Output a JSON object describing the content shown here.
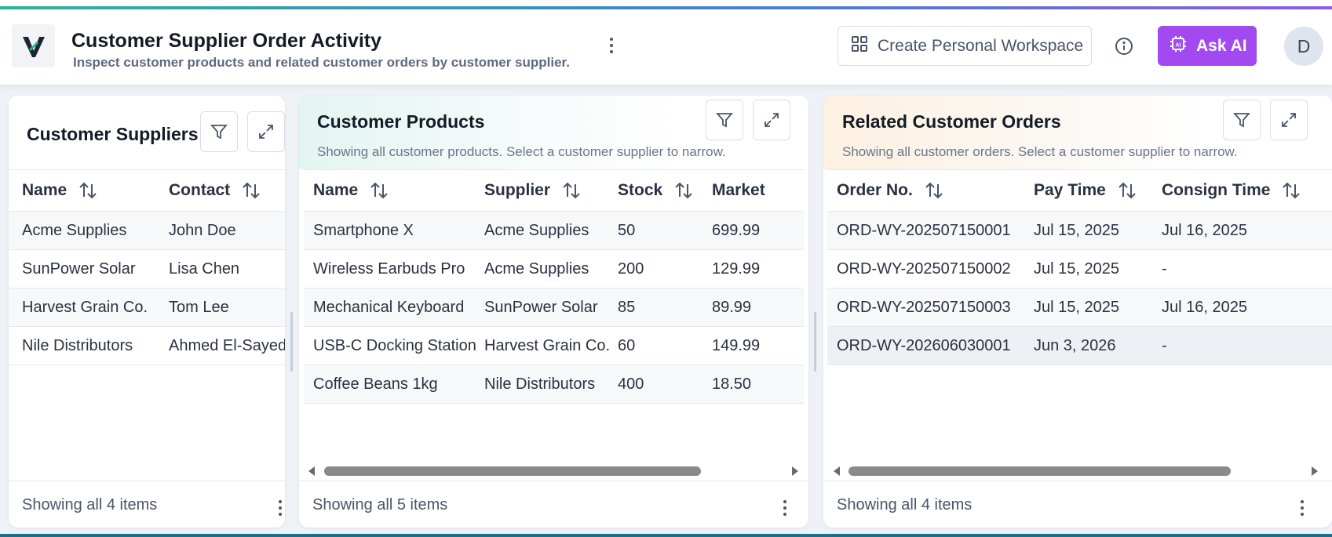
{
  "header": {
    "title": "Customer Supplier Order Activity",
    "subtitle": "Inspect customer products and related customer orders by customer supplier.",
    "workspace_label": "Create Personal Workspace",
    "ask_ai_label": "Ask AI",
    "avatar_initial": "D"
  },
  "colors": {
    "accent": "#a24af0",
    "gradient": [
      "#2bb39a",
      "#3f87c9",
      "#8e5ce6"
    ]
  },
  "suppliers": {
    "title": "Customer Suppliers",
    "columns": [
      "Name",
      "Contact"
    ],
    "rows": [
      [
        "Acme Supplies",
        "John Doe"
      ],
      [
        "SunPower Solar",
        "Lisa Chen"
      ],
      [
        "Harvest Grain Co.",
        "Tom Lee"
      ],
      [
        "Nile Distributors",
        "Ahmed El-Sayed"
      ]
    ],
    "footer": "Showing all 4 items"
  },
  "products": {
    "title": "Customer Products",
    "description": "Showing all customer products. Select a customer supplier to narrow.",
    "columns": [
      "Name",
      "Supplier",
      "Stock",
      "Market Price"
    ],
    "rows": [
      [
        "Smartphone X",
        "Acme Supplies",
        "50",
        "699.99"
      ],
      [
        "Wireless Earbuds Pro",
        "Acme Supplies",
        "200",
        "129.99"
      ],
      [
        "Mechanical Keyboard",
        "SunPower Solar",
        "85",
        "89.99"
      ],
      [
        "USB-C Docking Station",
        "Harvest Grain Co.",
        "60",
        "149.99"
      ],
      [
        "Coffee Beans 1kg",
        "Nile Distributors",
        "400",
        "18.50"
      ]
    ],
    "footer": "Showing all 5 items"
  },
  "orders": {
    "title": "Related Customer Orders",
    "description": "Showing all customer orders. Select a customer supplier to narrow.",
    "columns": [
      "Order No.",
      "Pay Time",
      "Consign Time"
    ],
    "rows": [
      [
        "ORD-WY-202507150001",
        "Jul 15, 2025",
        "Jul 16, 2025"
      ],
      [
        "ORD-WY-202507150002",
        "Jul 15, 2025",
        "-"
      ],
      [
        "ORD-WY-202507150003",
        "Jul 15, 2025",
        "Jul 16, 2025"
      ],
      [
        "ORD-WY-202606030001",
        "Jun 3, 2026",
        "-"
      ]
    ],
    "footer": "Showing all 4 items"
  },
  "icons": [
    "logo-icon",
    "more-vertical-icon",
    "grid-icon",
    "info-icon",
    "ai-chip-icon",
    "filter-icon",
    "expand-icon",
    "sort-icon"
  ]
}
